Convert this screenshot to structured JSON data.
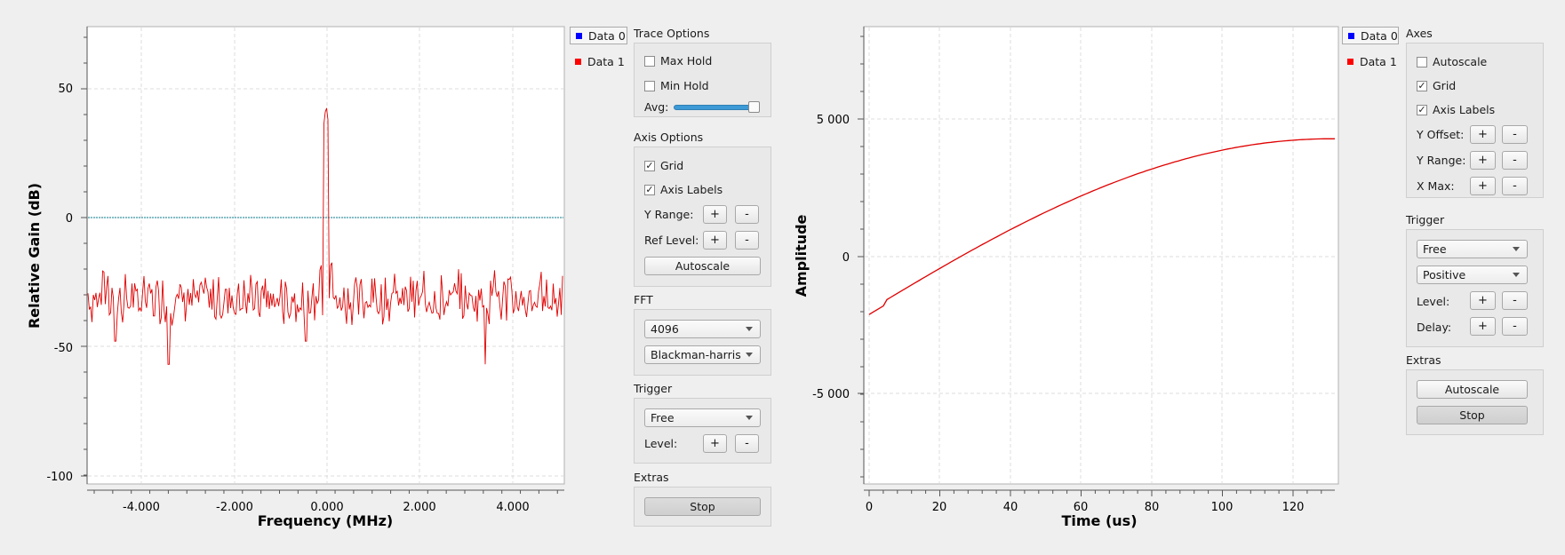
{
  "freq_plot": {
    "ylabel": "Relative Gain (dB)",
    "xlabel": "Frequency (MHz)",
    "y_ticks": [
      "50",
      "0",
      "-50",
      "-100"
    ],
    "x_ticks": [
      "-4.000",
      "-2.000",
      "0.000",
      "2.000",
      "4.000"
    ],
    "legend": [
      {
        "label": "Data 0",
        "color": "#0000ff"
      },
      {
        "label": "Data 1",
        "color": "#ff0000"
      }
    ]
  },
  "freq_controls": {
    "trace_options": {
      "title": "Trace Options",
      "max_hold": {
        "label": "Max Hold",
        "checked": false
      },
      "min_hold": {
        "label": "Min Hold",
        "checked": false
      },
      "avg_label": "Avg:",
      "avg_value": 1.0
    },
    "axis_options": {
      "title": "Axis Options",
      "grid": {
        "label": "Grid",
        "checked": true
      },
      "axis_labels": {
        "label": "Axis Labels",
        "checked": true
      },
      "y_range_label": "Y Range:",
      "ref_level_label": "Ref Level:",
      "plus": "+",
      "minus": "-",
      "autoscale": "Autoscale"
    },
    "fft": {
      "title": "FFT",
      "size": "4096",
      "window": "Blackman-harris"
    },
    "trigger": {
      "title": "Trigger",
      "mode": "Free",
      "level_label": "Level:",
      "plus": "+",
      "minus": "-"
    },
    "extras": {
      "title": "Extras",
      "stop": "Stop"
    }
  },
  "time_plot": {
    "ylabel": "Amplitude",
    "xlabel": "Time (us)",
    "y_ticks": [
      "5 000",
      "0",
      "-5 000"
    ],
    "x_ticks": [
      "0",
      "20",
      "40",
      "60",
      "80",
      "100",
      "120"
    ],
    "legend": [
      {
        "label": "Data 0",
        "color": "#0000ff"
      },
      {
        "label": "Data 1",
        "color": "#ff0000"
      }
    ]
  },
  "time_controls": {
    "axes": {
      "title": "Axes",
      "autoscale": {
        "label": "Autoscale",
        "checked": false
      },
      "grid": {
        "label": "Grid",
        "checked": true
      },
      "axis_labels": {
        "label": "Axis Labels",
        "checked": true
      },
      "y_offset_label": "Y Offset:",
      "y_range_label": "Y Range:",
      "x_max_label": "X Max:",
      "plus": "+",
      "minus": "-"
    },
    "trigger": {
      "title": "Trigger",
      "mode": "Free",
      "slope": "Positive",
      "level_label": "Level:",
      "delay_label": "Delay:",
      "plus": "+",
      "minus": "-"
    },
    "extras": {
      "title": "Extras",
      "autoscale": "Autoscale",
      "stop": "Stop"
    }
  },
  "colors": {
    "trace": "#e00000",
    "ref_line": "#0a7d8c",
    "grid": "#d8d8d8",
    "slider": "#3c9ad6"
  }
}
